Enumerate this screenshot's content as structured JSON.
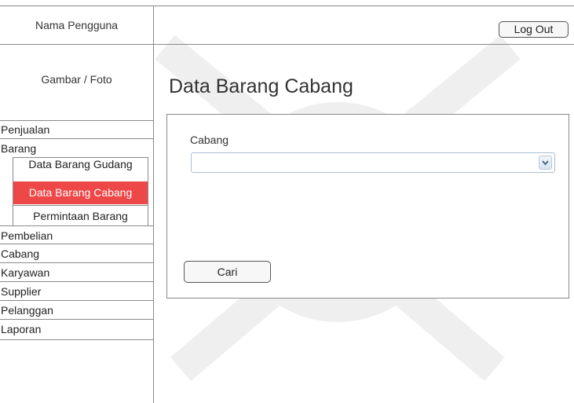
{
  "header": {
    "user_name": "Nama Pengguna",
    "logout_label": "Log Out"
  },
  "sidebar": {
    "photo_label": "Gambar / Foto",
    "items": [
      {
        "label": "Penjualan"
      },
      {
        "label": "Barang"
      },
      {
        "label": "Pembelian"
      },
      {
        "label": "Cabang"
      },
      {
        "label": "Karyawan"
      },
      {
        "label": "Supplier"
      },
      {
        "label": "Pelanggan"
      },
      {
        "label": "Laporan"
      }
    ],
    "submenu": [
      {
        "label": "Data Barang Gudang"
      },
      {
        "label": "Data Barang Cabang",
        "active": true
      },
      {
        "label": "Permintaan Barang"
      }
    ],
    "active_color": "#ee4747"
  },
  "main": {
    "title": "Data Barang Cabang",
    "form": {
      "cabang_label": "Cabang",
      "cabang_value": "",
      "search_label": "Cari"
    }
  }
}
